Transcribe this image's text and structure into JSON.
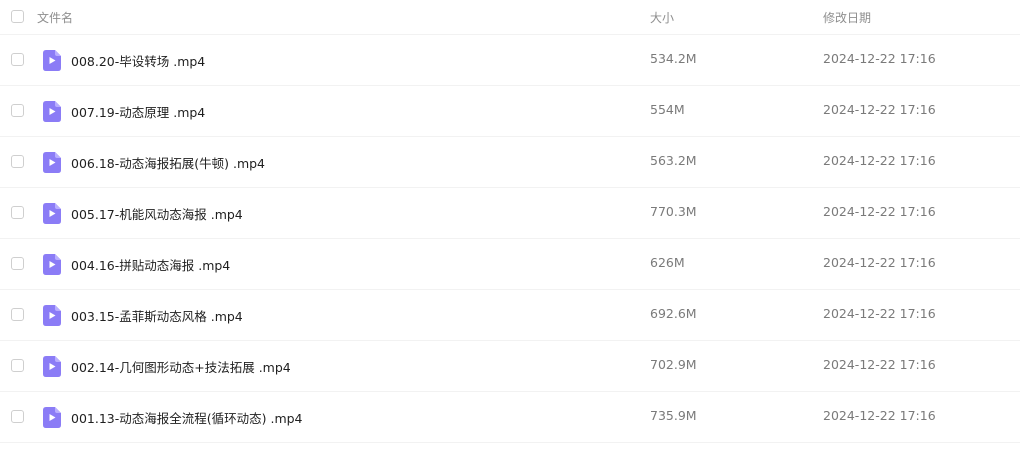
{
  "header": {
    "name_label": "文件名",
    "size_label": "大小",
    "date_label": "修改日期"
  },
  "files": [
    {
      "name": "008.20-毕设转场 .mp4",
      "size": "534.2M",
      "modified": "2024-12-22 17:16",
      "icon": "video-file-icon"
    },
    {
      "name": "007.19-动态原理 .mp4",
      "size": "554M",
      "modified": "2024-12-22 17:16",
      "icon": "video-file-icon"
    },
    {
      "name": "006.18-动态海报拓展(牛顿) .mp4",
      "size": "563.2M",
      "modified": "2024-12-22 17:16",
      "icon": "video-file-icon"
    },
    {
      "name": "005.17-机能风动态海报 .mp4",
      "size": "770.3M",
      "modified": "2024-12-22 17:16",
      "icon": "video-file-icon"
    },
    {
      "name": "004.16-拼贴动态海报 .mp4",
      "size": "626M",
      "modified": "2024-12-22 17:16",
      "icon": "video-file-icon"
    },
    {
      "name": "003.15-孟菲斯动态风格 .mp4",
      "size": "692.6M",
      "modified": "2024-12-22 17:16",
      "icon": "video-file-icon"
    },
    {
      "name": "002.14-几何图形动态+技法拓展 .mp4",
      "size": "702.9M",
      "modified": "2024-12-22 17:16",
      "icon": "video-file-icon"
    },
    {
      "name": "001.13-动态海报全流程(循环动态) .mp4",
      "size": "735.9M",
      "modified": "2024-12-22 17:16",
      "icon": "video-file-icon"
    }
  ],
  "colors": {
    "icon_accent": "#8b7cf6",
    "icon_fold": "#b9afff"
  }
}
